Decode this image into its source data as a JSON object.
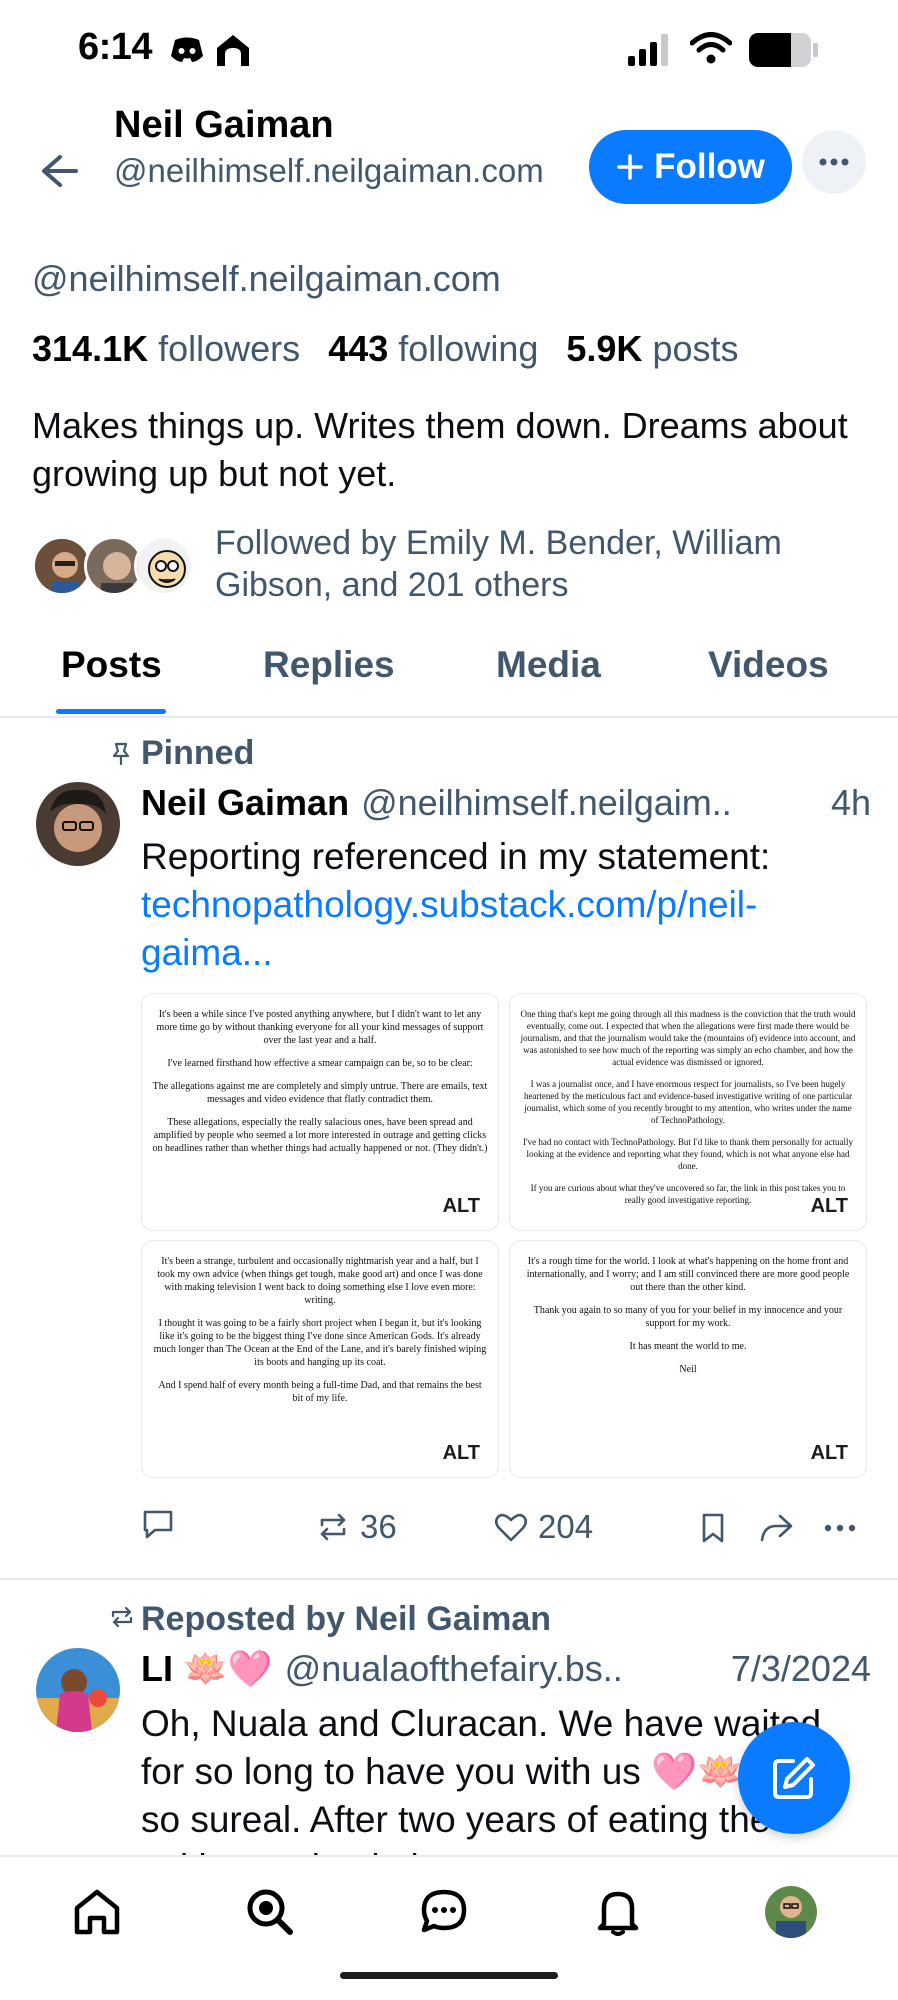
{
  "status_bar": {
    "time": "6:14"
  },
  "header": {
    "name": "Neil Gaiman",
    "handle": "@neilhimself.neilgaiman.com",
    "follow_label": "Follow",
    "follow_icon": "plus-icon",
    "more_icon": "ellipsis-icon"
  },
  "profile": {
    "handle": "@neilhimself.neilgaiman.com",
    "followers_count": "314.1K",
    "followers_label": "followers",
    "following_count": "443",
    "following_label": "following",
    "posts_count": "5.9K",
    "posts_label": "posts",
    "bio": "Makes things up. Writes them down. Dreams about growing up but not yet.",
    "followed_by": "Followed by Emily M. Bender, William Gibson, and 201 others"
  },
  "tabs": [
    {
      "label": "Posts",
      "active": true
    },
    {
      "label": "Replies",
      "active": false
    },
    {
      "label": "Media",
      "active": false
    },
    {
      "label": "Videos",
      "active": false
    }
  ],
  "pinned_post": {
    "pinned_label": "Pinned",
    "author_name": "Neil Gaiman",
    "author_handle": "@neilhimself.neilgaim..",
    "time": "4h",
    "text": "Reporting referenced in my statement:",
    "link_text": "technopathology.substack.com/p/neil-gaima...",
    "images": [
      {
        "alt_label": "ALT",
        "paragraphs": [
          "It's been a while since I've posted anything anywhere, but I didn't want to let any more time go by without thanking everyone for all your kind messages of support over the last year and a half.",
          "I've learned firsthand how effective a smear campaign can be, so to be clear:",
          "The allegations against me are completely and simply untrue. There are emails, text messages and video evidence that flatly contradict them.",
          "These allegations, especially the really salacious ones, have been spread and amplified by people who seemed a lot more interested in outrage and getting clicks on headlines rather than whether things had actually happened or not. (They didn't.)"
        ]
      },
      {
        "alt_label": "ALT",
        "paragraphs": [
          "One thing that's kept me going through all this madness is the conviction that the truth would eventually, come out. I expected that when the allegations were first made there would be journalism, and that the journalism would take the (mountains of) evidence into account, and was astonished to see how much of the reporting was simply an echo chamber, and how the actual evidence was dismissed or ignored.",
          "I was a journalist once, and I have enormous respect for journalists, so I've been hugely heartened by the meticulous fact and evidence-based investigative writing of one particular journalist, which some of you recently brought to my attention, who writes under the name of TechnoPathology.",
          "I've had no contact with TechnoPathology. But I'd like to thank them personally for actually looking at the evidence and reporting what they found, which is not what anyone else had done.",
          "If you are curious about what they've uncovered so far, the link in this post takes you to really good investigative reporting."
        ]
      },
      {
        "alt_label": "ALT",
        "paragraphs": [
          "It's been a strange, turbulent and occasionally nightmarish year and a half, but I took my own advice (when things get tough, make good art) and once I was done with making television I went back to doing something else I love even more: writing.",
          "I thought it was going to be a fairly short project when I began it, but it's looking like it's going to be the biggest thing I've done since American Gods. It's already much longer than The Ocean at the End of the Lane, and it's barely finished wiping its boots and hanging up its coat.",
          "And I spend half of every month being a full-time Dad, and that remains the best bit of my life."
        ]
      },
      {
        "alt_label": "ALT",
        "paragraphs": [
          "It's a rough time for the world. I look at what's happening on the home front and internationally, and I worry; and I am still convinced there are more good people out there than the other kind.",
          "Thank you again to so many of you for your belief in my innocence and your support for my work.",
          "It has meant the world to me.",
          "Neil"
        ]
      }
    ],
    "reply_count": "",
    "repost_count": "36",
    "like_count": "204"
  },
  "repost": {
    "reposted_by": "Reposted by Neil Gaiman",
    "author_name": "LI 🪷🩷",
    "author_handle": "@nualaofthefairy.bs..",
    "time": "7/3/2024",
    "text": "Oh, Nuala and Cluracan. We have waited for so long to have you with us 🩷🪷 this is so sureal. After two years of eating the writing and painting"
  },
  "colors": {
    "accent": "#0a7aff",
    "muted_text": "#42576c",
    "divider": "#e6eaee"
  },
  "bottom_nav": [
    {
      "icon": "home-icon"
    },
    {
      "icon": "search-icon"
    },
    {
      "icon": "chat-icon"
    },
    {
      "icon": "bell-icon"
    },
    {
      "icon": "profile-avatar"
    }
  ]
}
